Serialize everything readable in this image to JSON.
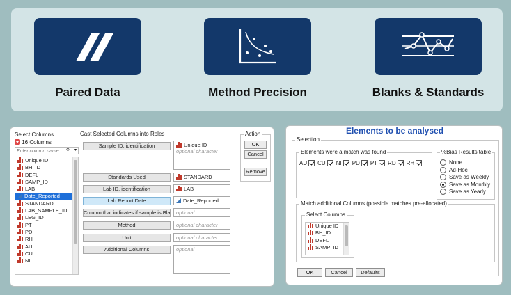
{
  "banner": {
    "tiles": [
      {
        "label": "Paired Data",
        "icon": "paired-slashes-icon"
      },
      {
        "label": "Method Precision",
        "icon": "scatter-curve-icon"
      },
      {
        "label": "Blanks & Standards",
        "icon": "control-chart-icon"
      }
    ],
    "tile_color": "#13386a"
  },
  "left": {
    "select_columns_title": "Select Columns",
    "column_count": "16 Columns",
    "search_placeholder": "Enter column name",
    "columns": [
      "Unique ID",
      "BH_ID",
      "DEFL",
      "SAMP_ID",
      "LAB",
      "Date_Reported",
      "STANDARD",
      "LAB_SAMPLE_ID",
      "LEG_ID",
      "PT",
      "PD",
      "RH",
      "AU",
      "CU",
      "NI"
    ],
    "selected_column": "Date_Reported",
    "cast_title": "Cast Selected Columns into Roles",
    "roles": [
      {
        "label": "Sample ID, identification",
        "value": "Unique ID",
        "hint": "optional character"
      },
      {
        "label": "Standards Used",
        "value": "STANDARD"
      },
      {
        "label": "Lab ID, identification",
        "value": "LAB"
      },
      {
        "label": "Lab Report Date",
        "value": "Date_Reported"
      },
      {
        "label": "Column that indicates if sample is Blank",
        "hint": "optional"
      },
      {
        "label": "Method",
        "hint": "optional character"
      },
      {
        "label": "Unit",
        "hint": "optional character"
      },
      {
        "label": "Additional Columns",
        "hint": "optional"
      }
    ],
    "action_title": "Action",
    "ok": "OK",
    "cancel": "Cancel",
    "remove": "Remove"
  },
  "right": {
    "title": "Elements to be analysed",
    "selection_title": "Selection",
    "elements_title": "Elements were a match was found",
    "elements": [
      "AU",
      "CU",
      "NI",
      "PD",
      "PT",
      "RD",
      "RH"
    ],
    "bias_title": "%Bias Results table",
    "bias_options": [
      "None",
      "Ad-Hoc",
      "Save as Weekly",
      "Save as Monthly",
      "Save as Yearly"
    ],
    "bias_selected": "Save as Monthly",
    "match_title": "Match additional Columns (possible matches pre-allocated)",
    "select_columns_title": "Select Columns",
    "match_columns": [
      "Unique ID",
      "BH_ID",
      "DEFL",
      "SAMP_ID"
    ],
    "ok": "OK",
    "cancel": "Cancel",
    "defaults": "Defaults"
  }
}
